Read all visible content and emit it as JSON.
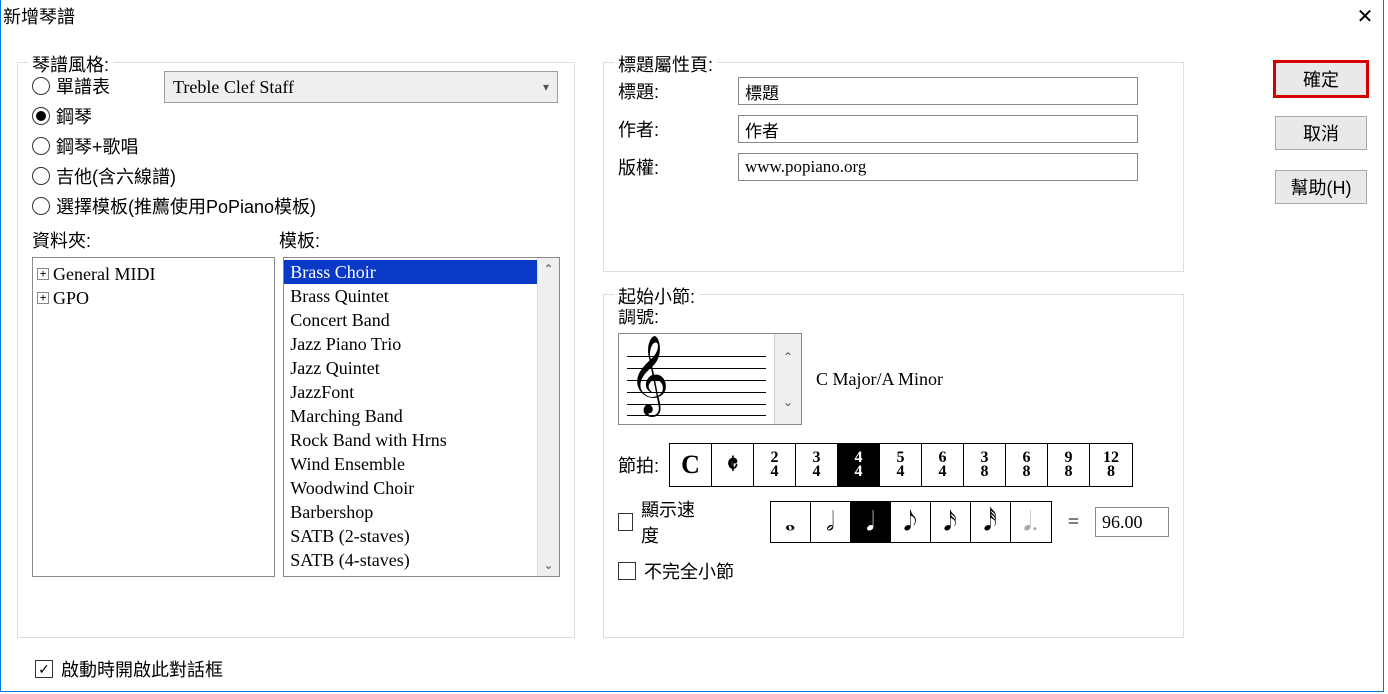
{
  "dialog": {
    "title": "新增琴譜"
  },
  "style": {
    "legend": "琴譜風格:",
    "radios": {
      "single_staff": "單譜表",
      "piano": "鋼琴",
      "piano_vocal": "鋼琴+歌唱",
      "guitar_tab": "吉他(含六線譜)",
      "choose_template": "選擇模板(推薦使用PoPiano模板)"
    },
    "dropdown_value": "Treble Clef Staff",
    "folder_label": "資料夾:",
    "template_label": "模板:",
    "folders": {
      "f0": "General MIDI",
      "f1": "GPO"
    },
    "templates": {
      "t0": "Brass Choir",
      "t1": "Brass Quintet",
      "t2": "Concert Band",
      "t3": "Jazz Piano Trio",
      "t4": "Jazz Quintet",
      "t5": "JazzFont",
      "t6": "Marching Band",
      "t7": "Rock Band with Hrns",
      "t8": "Wind Ensemble",
      "t9": "Woodwind Choir",
      "t10": "Barbershop",
      "t11": "SATB (2-staves)",
      "t12": "SATB (4-staves)"
    }
  },
  "titleprops": {
    "legend": "標題屬性頁:",
    "title_label": "標題:",
    "title_value": "標題",
    "author_label": "作者:",
    "author_value": "作者",
    "copyright_label": "版權:",
    "copyright_value": "www.popiano.org"
  },
  "start": {
    "legend": "起始小節:",
    "key_label": "調號:",
    "key_name": "C Major/A Minor",
    "timesig_label": "節拍:",
    "timesigs": {
      "c": "C",
      "cbar": "𝄵",
      "t2_4_top": "2",
      "t2_4_bot": "4",
      "t3_4_top": "3",
      "t3_4_bot": "4",
      "t4_4_top": "4",
      "t4_4_bot": "4",
      "t5_4_top": "5",
      "t5_4_bot": "4",
      "t6_4_top": "6",
      "t6_4_bot": "4",
      "t3_8_top": "3",
      "t3_8_bot": "8",
      "t6_8_top": "6",
      "t6_8_bot": "8",
      "t9_8_top": "9",
      "t9_8_bot": "8",
      "t12_8_top": "12",
      "t12_8_bot": "8"
    },
    "show_tempo_label": "顯示速度",
    "notes": {
      "whole": "𝅝",
      "half": "𝅗𝅥",
      "quarter": "𝅘𝅥",
      "eighth": "𝅘𝅥𝅮",
      "sixteenth": "𝅘𝅥𝅯",
      "thirtysecond": "𝅘𝅥𝅰",
      "dotted": "𝅘𝅥."
    },
    "eq": "=",
    "tempo_value": "96.00",
    "incomplete_label": "不完全小節"
  },
  "checks": {
    "startup_label": "啟動時開啟此對話框"
  },
  "buttons": {
    "ok": "確定",
    "cancel": "取消",
    "help": "幫助(H)"
  }
}
